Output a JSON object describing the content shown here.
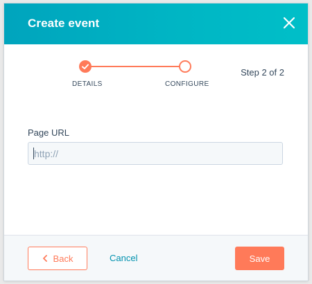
{
  "dialog": {
    "title": "Create event",
    "close_icon": "close-icon"
  },
  "stepper": {
    "steps": [
      {
        "label": "DETAILS",
        "status": "complete"
      },
      {
        "label": "CONFIGURE",
        "status": "current"
      }
    ],
    "counter": "Step 2 of 2"
  },
  "form": {
    "page_url_label": "Page URL",
    "page_url_placeholder": "http://",
    "page_url_value": ""
  },
  "footer": {
    "back_label": "Back",
    "cancel_label": "Cancel",
    "save_label": "Save"
  },
  "colors": {
    "header_start": "#00a4bd",
    "header_end": "#00bfc8",
    "accent": "#ff7a59",
    "link": "#0091ae",
    "text": "#33475b"
  }
}
